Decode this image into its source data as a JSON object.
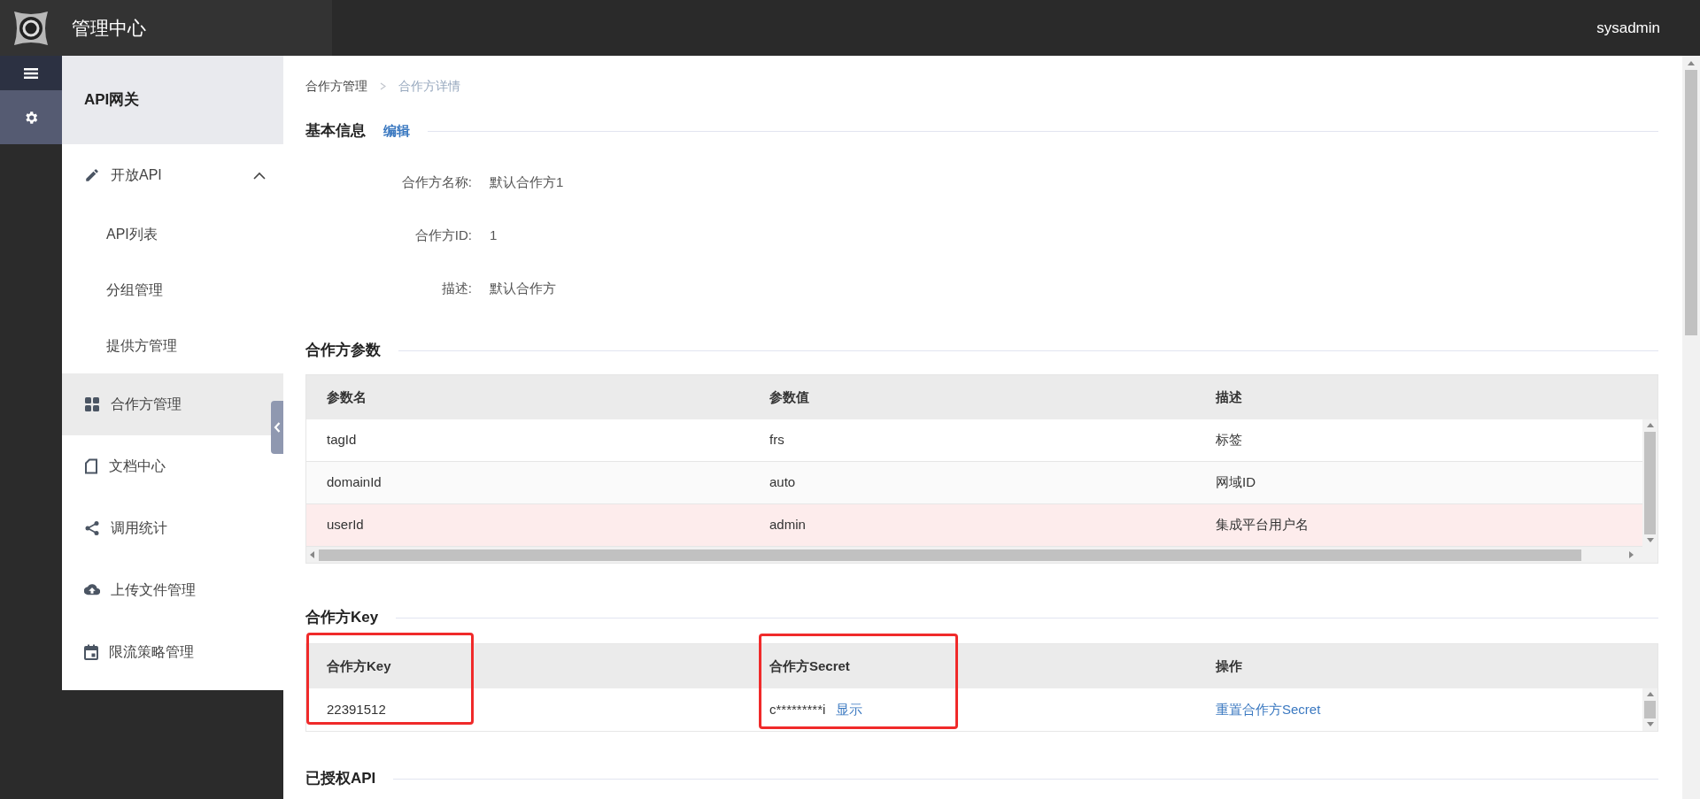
{
  "header": {
    "title": "管理中心",
    "user": "sysadmin"
  },
  "sidebar": {
    "title": "API网关",
    "items": [
      {
        "kind": "group",
        "label": "开放API",
        "expanded": true,
        "selected": false,
        "children": [
          {
            "label": "API列表",
            "selected": false
          },
          {
            "label": "分组管理",
            "selected": false
          },
          {
            "label": "提供方管理",
            "selected": false
          }
        ]
      },
      {
        "kind": "item",
        "label": "合作方管理",
        "selected": true
      },
      {
        "kind": "item",
        "label": "文档中心",
        "selected": false
      },
      {
        "kind": "item",
        "label": "调用统计",
        "selected": false
      },
      {
        "kind": "item",
        "label": "上传文件管理",
        "selected": false
      },
      {
        "kind": "item",
        "label": "限流策略管理",
        "selected": false
      }
    ]
  },
  "breadcrumb": [
    "合作方管理",
    "合作方详情"
  ],
  "basic_info": {
    "title": "基本信息",
    "edit_link": "编辑",
    "fields": [
      {
        "label": "合作方名称:",
        "value": "默认合作方1"
      },
      {
        "label": "合作方ID:",
        "value": "1"
      },
      {
        "label": "描述:",
        "value": "默认合作方"
      }
    ]
  },
  "params": {
    "title": "合作方参数",
    "columns": [
      "参数名",
      "参数值",
      "描述"
    ],
    "rows": [
      {
        "cells": [
          "tagId",
          "frs",
          "标签"
        ],
        "selected": false
      },
      {
        "cells": [
          "domainId",
          "auto",
          "网域ID"
        ],
        "selected": false
      },
      {
        "cells": [
          "userId",
          "admin",
          "集成平台用户名"
        ],
        "selected": true
      }
    ]
  },
  "keys": {
    "title": "合作方Key",
    "columns": [
      "合作方Key",
      "合作方Secret",
      "操作"
    ],
    "rows": [
      {
        "key": "22391512",
        "secret": "c*********i",
        "show_link": "显示",
        "action_link": "重置合作方Secret"
      }
    ]
  },
  "authorized": {
    "title": "已授权API"
  }
}
